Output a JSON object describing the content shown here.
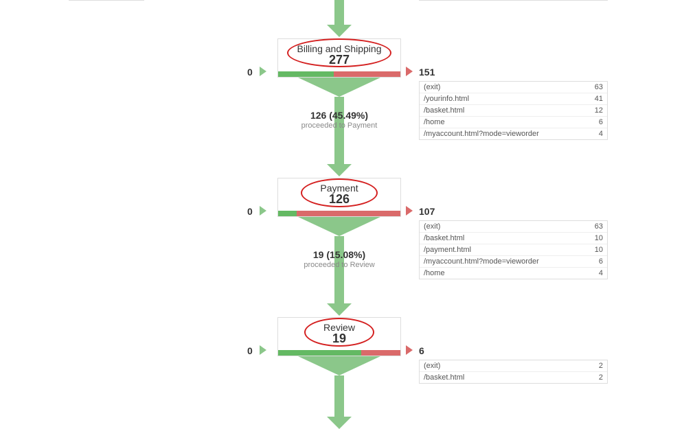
{
  "steps": [
    {
      "title": "Billing and Shipping",
      "count": "277",
      "in": "0",
      "out": "151",
      "greenPct": 45.49,
      "between": {
        "main": "126 (45.49%)",
        "sub": "proceeded to Payment"
      },
      "exits": [
        {
          "path": "(exit)",
          "n": "63"
        },
        {
          "path": "/yourinfo.html",
          "n": "41"
        },
        {
          "path": "/basket.html",
          "n": "12"
        },
        {
          "path": "/home",
          "n": "6"
        },
        {
          "path": "/myaccount.html?mode=vieworder",
          "n": "4"
        }
      ]
    },
    {
      "title": "Payment",
      "count": "126",
      "in": "0",
      "out": "107",
      "greenPct": 15.08,
      "between": {
        "main": "19 (15.08%)",
        "sub": "proceeded to Review"
      },
      "exits": [
        {
          "path": "(exit)",
          "n": "63"
        },
        {
          "path": "/basket.html",
          "n": "10"
        },
        {
          "path": "/payment.html",
          "n": "10"
        },
        {
          "path": "/myaccount.html?mode=vieworder",
          "n": "6"
        },
        {
          "path": "/home",
          "n": "4"
        }
      ]
    },
    {
      "title": "Review",
      "count": "19",
      "in": "0",
      "out": "6",
      "greenPct": 68,
      "between": null,
      "exits": [
        {
          "path": "(exit)",
          "n": "2"
        },
        {
          "path": "/basket.html",
          "n": "2"
        }
      ]
    }
  ]
}
